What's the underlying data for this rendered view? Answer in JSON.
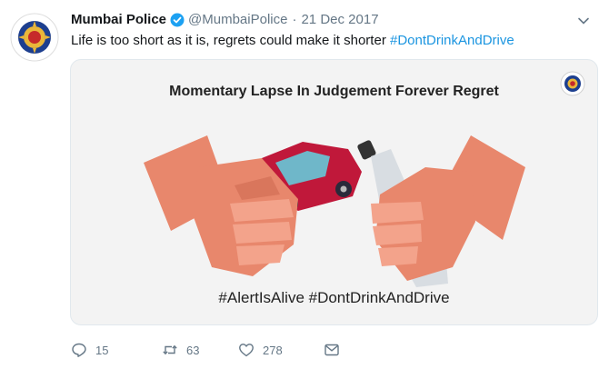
{
  "tweet": {
    "author_name": "Mumbai Police",
    "handle": "@MumbaiPolice",
    "separator": "·",
    "date": "21 Dec 2017",
    "text": "Life is too short as it is, regrets could make it shorter ",
    "hashtag": "#DontDrinkAndDrive"
  },
  "media": {
    "title": "Momentary Lapse In Judgement Forever Regret",
    "tags": "#AlertIsAlive #DontDrinkAndDrive"
  },
  "actions": {
    "replies": "15",
    "retweets": "63",
    "likes": "278"
  },
  "colors": {
    "link": "#1b95e0",
    "muted": "#657786",
    "verified": "#1da1f2",
    "hand": "#e8876c",
    "car": "#c0183a"
  },
  "icons": [
    "police-emblem-icon",
    "verified-badge-icon",
    "chevron-down-icon",
    "reply-icon",
    "retweet-icon",
    "like-icon",
    "message-icon"
  ]
}
